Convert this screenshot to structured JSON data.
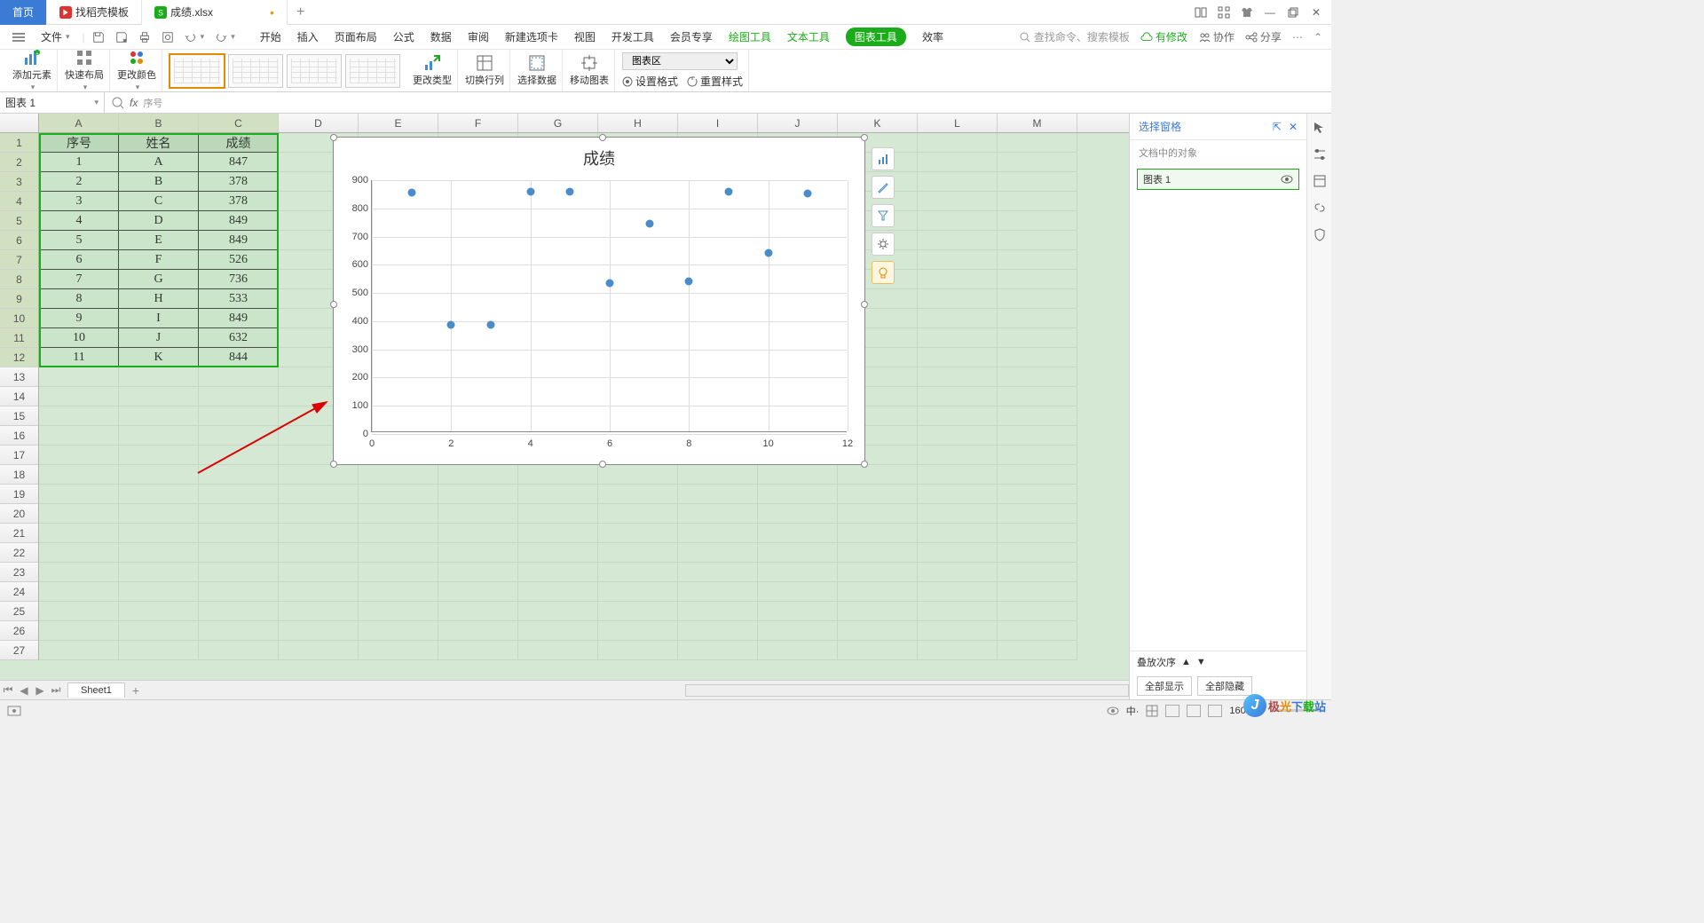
{
  "tabs": {
    "home": "首页",
    "template": "找稻壳模板",
    "file": "成绩.xlsx",
    "unsaved_dot": "•"
  },
  "menu": {
    "file": "文件",
    "items": [
      "开始",
      "插入",
      "页面布局",
      "公式",
      "数据",
      "审阅",
      "新建选项卡",
      "视图",
      "开发工具",
      "会员专享",
      "绘图工具",
      "文本工具",
      "图表工具",
      "效率"
    ],
    "search_placeholder": "查找命令、搜索模板",
    "search_prefix": "Q",
    "has_changes": "有修改",
    "coop": "协作",
    "share": "分享"
  },
  "ribbon": {
    "add_element": "添加元素",
    "quick_layout": "快速布局",
    "change_color": "更改颜色",
    "change_type": "更改类型",
    "switch_rc": "切换行列",
    "select_data": "选择数据",
    "move_chart": "移动图表",
    "area_select": "图表区",
    "set_format": "设置格式",
    "reset_style": "重置样式"
  },
  "formula": {
    "name_box": "图表 1",
    "fx": "fx",
    "content": "序号"
  },
  "columns": [
    "A",
    "B",
    "C",
    "D",
    "E",
    "F",
    "G",
    "H",
    "I",
    "J",
    "K",
    "L",
    "M"
  ],
  "table": {
    "headers": [
      "序号",
      "姓名",
      "成绩"
    ],
    "rows": [
      [
        "1",
        "A",
        "847"
      ],
      [
        "2",
        "B",
        "378"
      ],
      [
        "3",
        "C",
        "378"
      ],
      [
        "4",
        "D",
        "849"
      ],
      [
        "5",
        "E",
        "849"
      ],
      [
        "6",
        "F",
        "526"
      ],
      [
        "7",
        "G",
        "736"
      ],
      [
        "8",
        "H",
        "533"
      ],
      [
        "9",
        "I",
        "849"
      ],
      [
        "10",
        "J",
        "632"
      ],
      [
        "11",
        "K",
        "844"
      ]
    ]
  },
  "chart_data": {
    "type": "scatter",
    "title": "成绩",
    "x": [
      1,
      2,
      3,
      4,
      5,
      6,
      7,
      8,
      9,
      10,
      11
    ],
    "y": [
      847,
      378,
      378,
      849,
      849,
      526,
      736,
      533,
      849,
      632,
      844
    ],
    "xlim": [
      0,
      12
    ],
    "ylim": [
      0,
      900
    ],
    "yticks": [
      0,
      100,
      200,
      300,
      400,
      500,
      600,
      700,
      800,
      900
    ],
    "xticks": [
      0,
      2,
      4,
      6,
      8,
      10,
      12
    ]
  },
  "panel": {
    "title": "选择窗格",
    "subtitle": "文档中的对象",
    "item": "图表 1",
    "stack_order": "叠放次序",
    "show_all": "全部显示",
    "hide_all": "全部隐藏"
  },
  "sheet": {
    "name": "Sheet1"
  },
  "status": {
    "zoom": "160%"
  },
  "watermark": {
    "text": "极光下载站",
    "colors": [
      "#b34747",
      "#e28b00",
      "#3a7bd5",
      "#1aad19",
      "#3a7bd5",
      "#1aad19"
    ]
  }
}
